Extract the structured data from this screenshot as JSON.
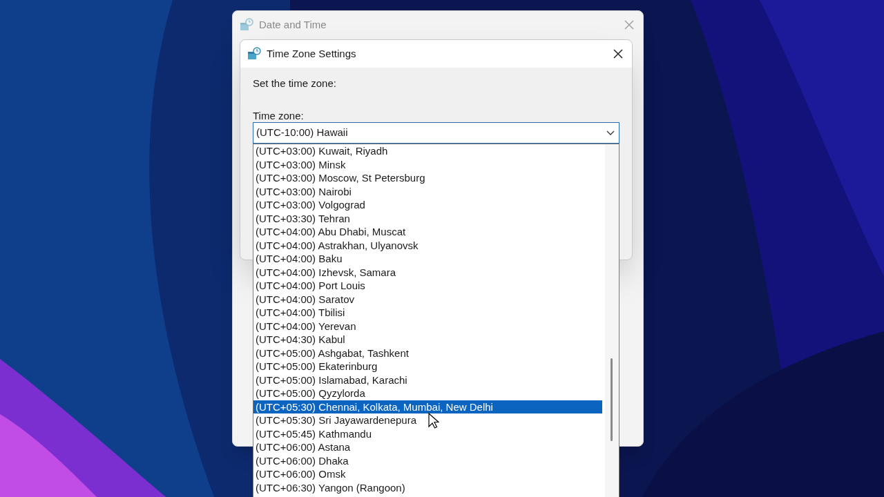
{
  "background_window": {
    "title": "Date and Time"
  },
  "dialog": {
    "title": "Time Zone Settings",
    "prompt": "Set the time zone:",
    "field_label": "Time zone:",
    "value": "(UTC-10:00) Hawaii",
    "options": [
      {
        "label": "(UTC+03:00) Kuwait, Riyadh",
        "selected": false
      },
      {
        "label": "(UTC+03:00) Minsk",
        "selected": false
      },
      {
        "label": "(UTC+03:00) Moscow, St Petersburg",
        "selected": false
      },
      {
        "label": "(UTC+03:00) Nairobi",
        "selected": false
      },
      {
        "label": "(UTC+03:00) Volgograd",
        "selected": false
      },
      {
        "label": "(UTC+03:30) Tehran",
        "selected": false
      },
      {
        "label": "(UTC+04:00) Abu Dhabi, Muscat",
        "selected": false
      },
      {
        "label": "(UTC+04:00) Astrakhan, Ulyanovsk",
        "selected": false
      },
      {
        "label": "(UTC+04:00) Baku",
        "selected": false
      },
      {
        "label": "(UTC+04:00) Izhevsk, Samara",
        "selected": false
      },
      {
        "label": "(UTC+04:00) Port Louis",
        "selected": false
      },
      {
        "label": "(UTC+04:00) Saratov",
        "selected": false
      },
      {
        "label": "(UTC+04:00) Tbilisi",
        "selected": false
      },
      {
        "label": "(UTC+04:00) Yerevan",
        "selected": false
      },
      {
        "label": "(UTC+04:30) Kabul",
        "selected": false
      },
      {
        "label": "(UTC+05:00) Ashgabat, Tashkent",
        "selected": false
      },
      {
        "label": "(UTC+05:00) Ekaterinburg",
        "selected": false
      },
      {
        "label": "(UTC+05:00) Islamabad, Karachi",
        "selected": false
      },
      {
        "label": "(UTC+05:00) Qyzylorda",
        "selected": false
      },
      {
        "label": "(UTC+05:30) Chennai, Kolkata, Mumbai, New Delhi",
        "selected": true
      },
      {
        "label": "(UTC+05:30) Sri Jayawardenepura",
        "selected": false
      },
      {
        "label": "(UTC+05:45) Kathmandu",
        "selected": false
      },
      {
        "label": "(UTC+06:00) Astana",
        "selected": false
      },
      {
        "label": "(UTC+06:00) Dhaka",
        "selected": false
      },
      {
        "label": "(UTC+06:00) Omsk",
        "selected": false
      },
      {
        "label": "(UTC+06:30) Yangon (Rangoon)",
        "selected": false
      }
    ]
  }
}
